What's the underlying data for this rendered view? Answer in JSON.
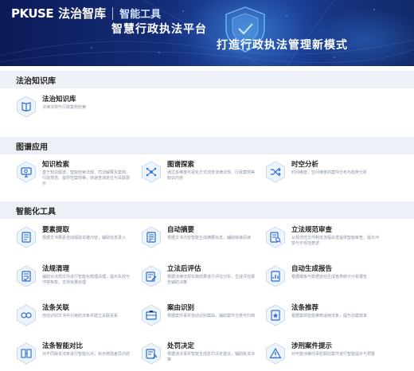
{
  "header": {
    "brand": "PKUSE",
    "brand_cn": "法治智库",
    "tool_label": "智能工具",
    "slogan_main": "智慧行政执法平台",
    "slogan_sub": "打造行政执法管理新模式"
  },
  "sections": [
    {
      "title": "法治知识库",
      "items": [
        {
          "title": "法治知识库",
          "desc": "法律法规与行政案例检索",
          "icon": "book-icon"
        }
      ]
    },
    {
      "title": "图谱应用",
      "items": [
        {
          "title": "知识检索",
          "desc": "基于知识图谱，智能检索法规、司法解释及案例、行政规范、指导性案例等，快速查询定位与关联展示",
          "icon": "monitor-search-icon"
        },
        {
          "title": "图谱探索",
          "desc": "通过多维度可视化方式浏览法律法规、行政案例等知识内容",
          "icon": "graph-nodes-icon"
        },
        {
          "title": "时空分析",
          "desc": "时间维度，空间维度的案件分布与趋势分析",
          "icon": "shuffle-icon"
        }
      ]
    },
    {
      "title": "智能化工具",
      "items": [
        {
          "title": "要素提取",
          "desc": "根据文书要素自动提取关键内容，辅助信息录入",
          "icon": "document-list-icon"
        },
        {
          "title": "自动摘要",
          "desc": "根据文书内容智能生成摘要信息，辅助快速阅读",
          "icon": "summary-icon"
        },
        {
          "title": "立法规范审查",
          "desc": "从规范性文件制定流程出发提供智能审查，提示冲突与不规范表述",
          "icon": "review-icon"
        },
        {
          "title": "法规清理",
          "desc": "辅助对法规文件进行智能化梳理清理，提示失效与冲突条款，支持批量处理",
          "icon": "cleanup-icon"
        },
        {
          "title": "立法后评估",
          "desc": "根据法律法规实施效果进行评估分析，生成评估报告辅助决策",
          "icon": "evaluate-icon"
        },
        {
          "title": "自动生成报告",
          "desc": "根据模板与数据自动生成各类统计分析报告",
          "icon": "report-icon"
        },
        {
          "title": "法条关联",
          "desc": "自动识别文书中引用的法条并建立关联关系",
          "icon": "link-icon"
        },
        {
          "title": "案由识别",
          "desc": "根据案件事实自动识别案由，辅助案件分类与归档",
          "icon": "case-icon"
        },
        {
          "title": "法条推荐",
          "desc": "根据案情智能推荐适用法条，提升办案效率",
          "icon": "recommend-icon"
        },
        {
          "title": "法条智能对比",
          "desc": "对不同版本法条进行智能比对，标示修改差异内容",
          "icon": "compare-icon"
        },
        {
          "title": "处罚决定",
          "desc": "根据违法事实智能生成处罚决定建议，辅助执法决策",
          "icon": "penalty-icon"
        },
        {
          "title": "涉刑案件提示",
          "desc": "对可能涉嫌刑事犯罪的案件进行智能提示与预警",
          "icon": "alert-icon"
        }
      ]
    }
  ]
}
